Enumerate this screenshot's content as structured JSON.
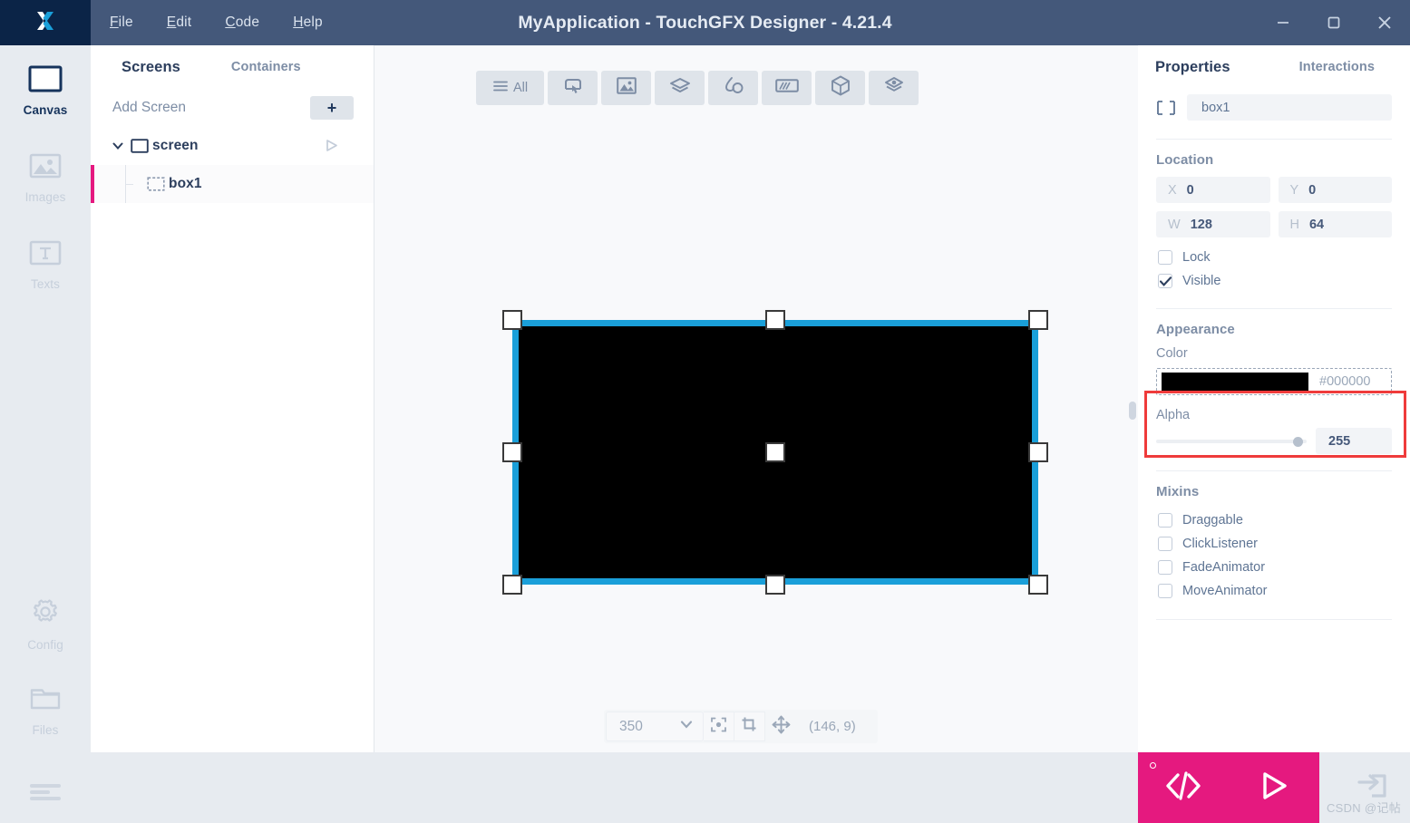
{
  "window": {
    "title": "MyApplication - TouchGFX Designer - 4.21.4",
    "app_name": "MyApplication",
    "product": "TouchGFX Designer",
    "version": "4.21.4",
    "logo_icon": "touchgfx-x-logo-icon",
    "controls": [
      {
        "name": "minimize-button",
        "icon": "minimize-icon"
      },
      {
        "name": "maximize-button",
        "icon": "maximize-square-icon"
      },
      {
        "name": "close-button",
        "icon": "close-x-icon"
      }
    ]
  },
  "menubar": {
    "items": [
      {
        "label": "File",
        "accel": "F"
      },
      {
        "label": "Edit",
        "accel": "E"
      },
      {
        "label": "Code",
        "accel": "C"
      },
      {
        "label": "Help",
        "accel": "H"
      }
    ]
  },
  "rail": {
    "items": [
      {
        "label": "Canvas",
        "icon": "canvas-rect-icon",
        "active": true
      },
      {
        "label": "Images",
        "icon": "image-picture-icon",
        "active": false
      },
      {
        "label": "Texts",
        "icon": "text-t-icon",
        "active": false
      },
      {
        "label": "Config",
        "icon": "gear-icon",
        "active": false
      },
      {
        "label": "Files",
        "icon": "folder-icon",
        "active": false
      }
    ],
    "hamburger_icon": "hamburger-menu-icon"
  },
  "tree_panel": {
    "tabs": [
      {
        "label": "Screens",
        "active": true
      },
      {
        "label": "Containers",
        "active": false
      }
    ],
    "add_screen_label": "Add Screen",
    "add_button_label": "+",
    "nodes": [
      {
        "label": "screen",
        "icon": "screen-rect-icon",
        "expanded": true,
        "selected": false,
        "level": 0,
        "play_icon": "play-triangle-icon"
      },
      {
        "label": "box1",
        "icon": "box-dashed-rect-icon",
        "expanded": false,
        "selected": true,
        "level": 1
      }
    ]
  },
  "canvas": {
    "widget_toolbar": [
      {
        "label": "All",
        "icon": "list-lines-icon",
        "name": "filter-all-button"
      },
      {
        "label": "",
        "icon": "button-touch-icon",
        "name": "buttons-category-button"
      },
      {
        "label": "",
        "icon": "image-picture-icon",
        "name": "images-category-button"
      },
      {
        "label": "",
        "icon": "layers-stack-icon",
        "name": "containers-category-button"
      },
      {
        "label": "",
        "icon": "shapes-circle-drop-icon",
        "name": "shapes-category-button"
      },
      {
        "label": "",
        "icon": "gauge-progress-icon",
        "name": "progress-category-button"
      },
      {
        "label": "",
        "icon": "cube-3d-icon",
        "name": "miscellaneous-category-button"
      },
      {
        "label": "",
        "icon": "layers-diamond-icon",
        "name": "custom-category-button"
      }
    ],
    "selected_widget": {
      "name": "box1",
      "fill_color": "#000000",
      "selection_color": "#1a9fd9",
      "handle_count": 8
    },
    "bottom_bar": {
      "zoom_value": "350",
      "zoom_dropdown_icon": "chevron-down-icon",
      "center_icon": "center-focus-icon",
      "crop_icon": "crop-frame-icon",
      "pan_icon": "move-arrows-icon",
      "coordinates": "(146, 9)"
    }
  },
  "properties": {
    "tabs": [
      {
        "label": "Properties",
        "active": true
      },
      {
        "label": "Interactions",
        "active": false
      }
    ],
    "widget_icon": "box-dashed-rect-icon",
    "widget_name": "box1",
    "location": {
      "title": "Location",
      "fields": [
        {
          "key": "X",
          "value": "0"
        },
        {
          "key": "Y",
          "value": "0"
        },
        {
          "key": "W",
          "value": "128"
        },
        {
          "key": "H",
          "value": "64"
        }
      ],
      "checkboxes": [
        {
          "label": "Lock",
          "checked": false
        },
        {
          "label": "Visible",
          "checked": true
        }
      ]
    },
    "appearance": {
      "title": "Appearance",
      "color_label": "Color",
      "color_hex": "#000000",
      "alpha_label": "Alpha",
      "alpha_value": "255"
    },
    "mixins": {
      "title": "Mixins",
      "items": [
        {
          "label": "Draggable",
          "checked": false
        },
        {
          "label": "ClickListener",
          "checked": false
        },
        {
          "label": "FadeAnimator",
          "checked": false
        },
        {
          "label": "MoveAnimator",
          "checked": false
        }
      ]
    },
    "annotation_color": "#ef3b3b"
  },
  "bottom_bar": {
    "generate_code_icon": "code-brackets-icon",
    "run_icon": "play-triangle-icon",
    "export_icon": "export-arrow-icon",
    "accent_color": "#e5197f",
    "watermark": "CSDN @记帖"
  }
}
